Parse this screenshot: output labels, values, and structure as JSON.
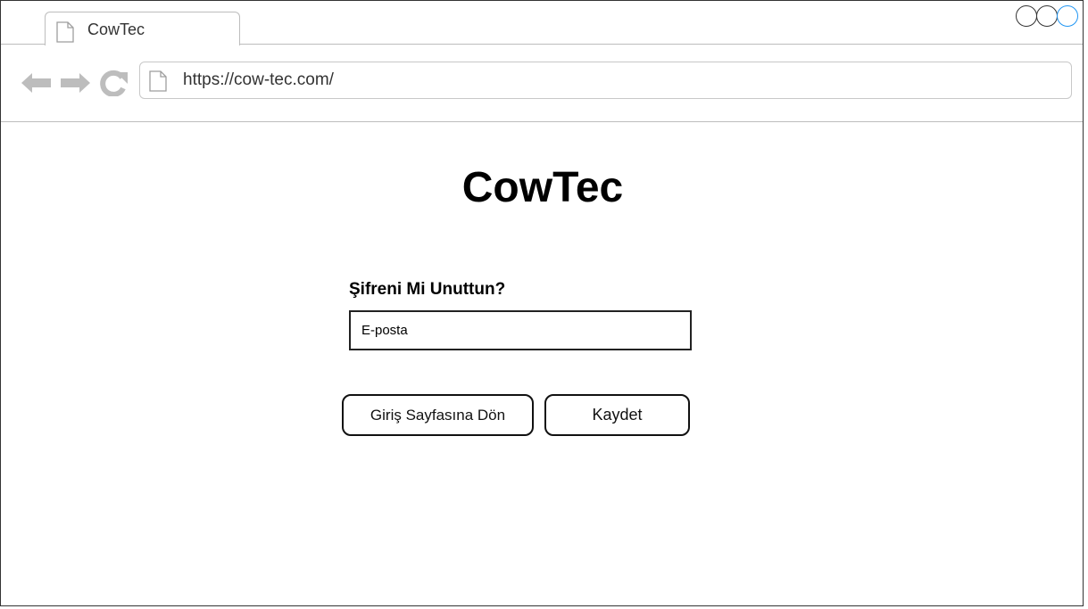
{
  "browser": {
    "tab_title": "CowTec",
    "url": "https://cow-tec.com/",
    "window_controls": [
      "circle",
      "circle",
      "circle"
    ],
    "accent_color": "#2196f3"
  },
  "nav_icons": {
    "back": "arrow-left-icon",
    "forward": "arrow-right-icon",
    "reload": "reload-icon",
    "page": "page-icon"
  },
  "page": {
    "title": "CowTec",
    "form_heading": "Şifreni Mi Unuttun?",
    "email_placeholder": "E-posta",
    "back_button_label": "Giriş Sayfasına Dön",
    "save_button_label": "Kaydet"
  }
}
